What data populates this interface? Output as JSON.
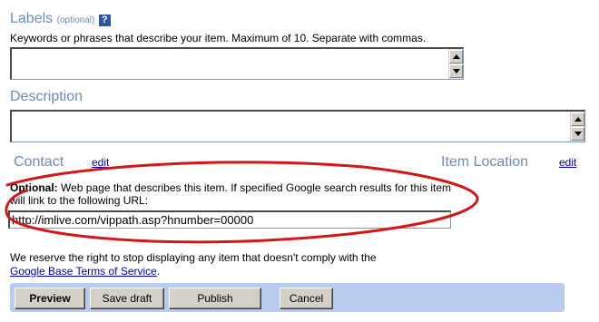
{
  "labels": {
    "title": "Labels",
    "optional": "(optional)",
    "help": "?",
    "description": "Keywords or phrases that describe your item. Maximum of 10. Separate with commas.",
    "value": ""
  },
  "description": {
    "title": "Description",
    "value": ""
  },
  "contact": {
    "title": "Contact",
    "edit": "edit"
  },
  "item_location": {
    "title": "Item Location",
    "edit": "edit"
  },
  "optional_url": {
    "label": "Optional:",
    "text": " Web page that describes this item. If specified Google search results for this item will link to the following URL:",
    "value": "http://imlive.com/vippath.asp?hnumber=00000"
  },
  "terms": {
    "text": "We reserve the right to stop displaying any item that doesn't comply with the",
    "link": "Google Base Terms of Service",
    "suffix": "."
  },
  "buttons": {
    "preview": "Preview",
    "save_draft": "Save draft",
    "publish": "Publish",
    "cancel": "Cancel"
  },
  "colors": {
    "section_title": "#6B8CBE",
    "link": "#0000CC",
    "annotation_circle": "#D01818",
    "button_bar": "#B7CCEE"
  }
}
